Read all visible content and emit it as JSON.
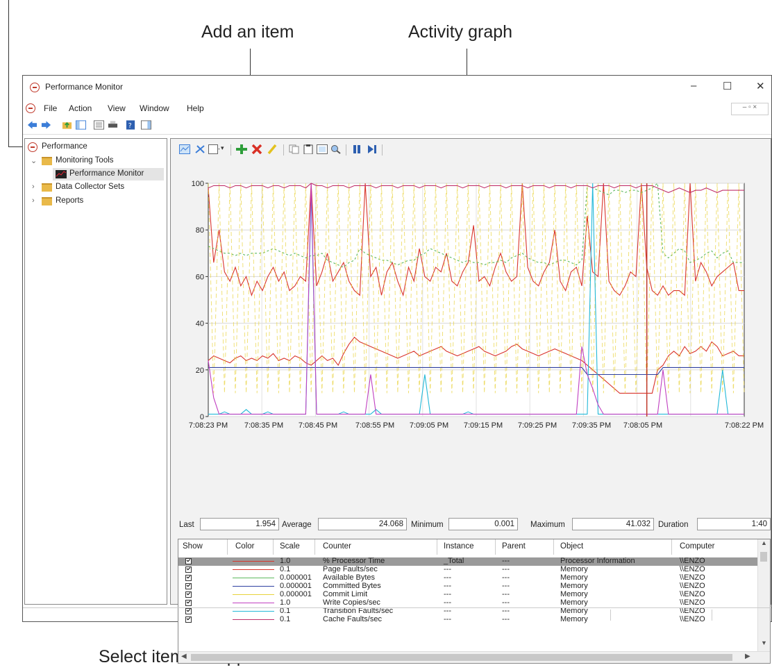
{
  "callouts": {
    "add_item": "Add an item",
    "activity_graph": "Activity graph",
    "select_items": "Select items to appear"
  },
  "window": {
    "title": "Performance Monitor",
    "minimize": "–",
    "maximize": "☐",
    "close": "✕",
    "mdi_buttons": "–  ▫  ×"
  },
  "menu": [
    "File",
    "Action",
    "View",
    "Window",
    "Help"
  ],
  "tree": {
    "root": "Performance",
    "monitoring_tools": "Monitoring Tools",
    "performance_monitor": "Performance Monitor",
    "data_collector_sets": "Data Collector Sets",
    "reports": "Reports"
  },
  "colors": {
    "accent_blue": "#3b7dd8",
    "add_green": "#2e9e3a",
    "delete_red": "#d93025",
    "highlight_yellow": "#e3c21f"
  },
  "icons": [
    "performance-icon",
    "back-icon",
    "forward-icon",
    "up-folder-icon",
    "console-tree-icon",
    "properties-icon",
    "export-icon",
    "help-icon",
    "action-pane-icon",
    "view-graph-icon",
    "freeze-icon",
    "change-graph-type-icon",
    "add-counter-icon",
    "delete-counter-icon",
    "highlight-icon",
    "copy-icon",
    "paste-icon",
    "properties-icon",
    "zoom-icon",
    "pause-icon",
    "update-data-icon"
  ],
  "stats": {
    "last_label": "Last",
    "last_value": "1.954",
    "average_label": "Average",
    "average_value": "24.068",
    "minimum_label": "Minimum",
    "minimum_value": "0.001",
    "maximum_label": "Maximum",
    "maximum_value": "41.032",
    "duration_label": "Duration",
    "duration_value": "1:40"
  },
  "counter_table": {
    "headers": [
      "Show",
      "Color",
      "Scale",
      "Counter",
      "Instance",
      "Parent",
      "Object",
      "Computer"
    ],
    "rows": [
      {
        "show": true,
        "color": "#d9342b",
        "scale": "1.0",
        "counter": "% Processor Time",
        "instance": "_Total",
        "parent": "---",
        "object": "Processor Information",
        "computer": "\\\\ENZO",
        "selected": true
      },
      {
        "show": true,
        "color": "#d9342b",
        "scale": "0.1",
        "counter": "Page Faults/sec",
        "instance": "---",
        "parent": "---",
        "object": "Memory",
        "computer": "\\\\ENZO"
      },
      {
        "show": true,
        "color": "#5cb85c",
        "scale": "0.000001",
        "counter": "Available Bytes",
        "instance": "---",
        "parent": "---",
        "object": "Memory",
        "computer": "\\\\ENZO"
      },
      {
        "show": true,
        "color": "#2d3fa0",
        "scale": "0.000001",
        "counter": "Committed Bytes",
        "instance": "---",
        "parent": "---",
        "object": "Memory",
        "computer": "\\\\ENZO"
      },
      {
        "show": true,
        "color": "#e8d23a",
        "scale": "0.000001",
        "counter": "Commit Limit",
        "instance": "---",
        "parent": "---",
        "object": "Memory",
        "computer": "\\\\ENZO"
      },
      {
        "show": true,
        "color": "#c03fc0",
        "scale": "1.0",
        "counter": "Write Copies/sec",
        "instance": "---",
        "parent": "---",
        "object": "Memory",
        "computer": "\\\\ENZO"
      },
      {
        "show": true,
        "color": "#22b8d8",
        "scale": "0.1",
        "counter": "Transition Faults/sec",
        "instance": "---",
        "parent": "---",
        "object": "Memory",
        "computer": "\\\\ENZO"
      },
      {
        "show": true,
        "color": "#c0306a",
        "scale": "0.1",
        "counter": "Cache Faults/sec",
        "instance": "---",
        "parent": "---",
        "object": "Memory",
        "computer": "\\\\ENZO"
      }
    ]
  },
  "chart_data": {
    "type": "line",
    "yticks": [
      "100",
      "80",
      "60",
      "40",
      "20",
      "0"
    ],
    "ylim": [
      0,
      100
    ],
    "xticks": [
      "7:08:23 PM",
      "7:08:35 PM",
      "7:08:45 PM",
      "7:08:55 PM",
      "7:09:05 PM",
      "7:09:15 PM",
      "7:09:25 PM",
      "7:09:35 PM",
      "7:08:05 PM",
      "7:08:22 PM"
    ],
    "grid": true,
    "sample_count": 100,
    "series": [
      {
        "color": "#d9342b",
        "style": "solid",
        "values": [
          98,
          66,
          80,
          62,
          58,
          64,
          56,
          60,
          52,
          58,
          54,
          60,
          64,
          58,
          62,
          54,
          56,
          60,
          58,
          100,
          56,
          62,
          70,
          58,
          62,
          66,
          58,
          54,
          52,
          100,
          60,
          64,
          52,
          62,
          66,
          58,
          52,
          64,
          58,
          72,
          60,
          58,
          64,
          62,
          70,
          58,
          56,
          62,
          66,
          82,
          58,
          60,
          56,
          64,
          70,
          62,
          58,
          60,
          100,
          64,
          58,
          56,
          62,
          66,
          80,
          58,
          54,
          62,
          64,
          56,
          86,
          62,
          60,
          100,
          58,
          54,
          52,
          56,
          62,
          60,
          100,
          64,
          54,
          52,
          56,
          52,
          54,
          54,
          52,
          100,
          58,
          66,
          62,
          56,
          60,
          62,
          64,
          66,
          54,
          54
        ]
      },
      {
        "color": "#d9342b",
        "style": "solid",
        "values": [
          24,
          26,
          25,
          24,
          23,
          25,
          26,
          24,
          25,
          24,
          26,
          25,
          27,
          24,
          25,
          24,
          26,
          25,
          23,
          22,
          24,
          26,
          24,
          25,
          22,
          27,
          31,
          34,
          32,
          31,
          30,
          29,
          28,
          27,
          26,
          25,
          26,
          27,
          28,
          26,
          27,
          28,
          29,
          30,
          28,
          27,
          26,
          27,
          28,
          29,
          30,
          28,
          27,
          26,
          27,
          28,
          30,
          31,
          29,
          28,
          27,
          26,
          27,
          28,
          29,
          28,
          27,
          26,
          25,
          24,
          22,
          20,
          18,
          16,
          14,
          12,
          10,
          10,
          10,
          10,
          10,
          10,
          10,
          20,
          22,
          26,
          28,
          26,
          30,
          27,
          28,
          30,
          28,
          32,
          30,
          26,
          27,
          28,
          26,
          26
        ]
      },
      {
        "color": "#5cb85c",
        "style": "dashed",
        "values": [
          73,
          72,
          71,
          70,
          70,
          69,
          70,
          69,
          70,
          70,
          70,
          71,
          72,
          71,
          70,
          69,
          70,
          69,
          68,
          69,
          69,
          70,
          67,
          66,
          65,
          64,
          66,
          67,
          72,
          70,
          69,
          68,
          67,
          67,
          66,
          65,
          66,
          67,
          67,
          69,
          70,
          72,
          71,
          70,
          69,
          68,
          67,
          66,
          67,
          66,
          66,
          65,
          66,
          66,
          67,
          66,
          68,
          69,
          70,
          68,
          67,
          66,
          66,
          65,
          66,
          67,
          67,
          66,
          65,
          67,
          99,
          98,
          97,
          96,
          95,
          97,
          97,
          96,
          97,
          97,
          96,
          97,
          98,
          100,
          70,
          68,
          70,
          72,
          71,
          66,
          67,
          68,
          70,
          71,
          68,
          70,
          71,
          66,
          66,
          66
        ]
      },
      {
        "color": "#e8d23a",
        "style": "dashed",
        "values": [
          100,
          10,
          100,
          10,
          100,
          10,
          100,
          10,
          100,
          10,
          100,
          10,
          100,
          10,
          100,
          10,
          100,
          10,
          100,
          10,
          100,
          10,
          100,
          10,
          100,
          10,
          100,
          10,
          100,
          10,
          100,
          10,
          100,
          10,
          100,
          10,
          100,
          10,
          100,
          10,
          100,
          10,
          100,
          10,
          100,
          10,
          100,
          10,
          100,
          10,
          100,
          10,
          100,
          10,
          100,
          10,
          100,
          10,
          100,
          10,
          100,
          10,
          100,
          10,
          100,
          10,
          100,
          10,
          100,
          10,
          100,
          10,
          100,
          10,
          100,
          10,
          100,
          10,
          100,
          10,
          100,
          10,
          100,
          10,
          100,
          10,
          100,
          10,
          100,
          10,
          100,
          10,
          100,
          10,
          100,
          10,
          100,
          10,
          100,
          10
        ]
      },
      {
        "color": "#2d3fa0",
        "style": "solid",
        "values": [
          21,
          21,
          21,
          21,
          21,
          21,
          21,
          21,
          21,
          21,
          21,
          21,
          21,
          21,
          21,
          21,
          21,
          21,
          21,
          21,
          21,
          21,
          21,
          21,
          21,
          21,
          21,
          21,
          21,
          21,
          21,
          21,
          21,
          21,
          21,
          21,
          21,
          21,
          21,
          21,
          21,
          21,
          21,
          21,
          21,
          21,
          21,
          21,
          21,
          21,
          21,
          21,
          21,
          21,
          21,
          21,
          21,
          21,
          21,
          21,
          21,
          21,
          21,
          21,
          21,
          21,
          21,
          21,
          21,
          21,
          18,
          18,
          18,
          18,
          18,
          18,
          18,
          18,
          18,
          18,
          18,
          18,
          18,
          18,
          21,
          21,
          21,
          21,
          21,
          21,
          21,
          21,
          21,
          21,
          21,
          21,
          21,
          21,
          21,
          21
        ]
      },
      {
        "color": "#22b8d8",
        "style": "solid",
        "values": [
          1,
          1,
          1,
          2,
          1,
          1,
          1,
          3,
          1,
          1,
          1,
          2,
          1,
          1,
          1,
          1,
          1,
          1,
          1,
          95,
          1,
          1,
          1,
          1,
          1,
          2,
          1,
          1,
          1,
          1,
          1,
          3,
          1,
          1,
          1,
          1,
          1,
          1,
          1,
          1,
          18,
          1,
          1,
          1,
          1,
          1,
          1,
          1,
          2,
          1,
          1,
          1,
          1,
          1,
          1,
          1,
          1,
          1,
          1,
          1,
          1,
          1,
          1,
          1,
          1,
          1,
          1,
          1,
          1,
          1,
          1,
          100,
          1,
          1,
          1,
          1,
          1,
          1,
          1,
          1,
          1,
          1,
          1,
          1,
          1,
          1,
          1,
          1,
          1,
          1,
          1,
          1,
          1,
          1,
          1,
          20,
          1,
          1,
          1,
          1
        ]
      },
      {
        "color": "#c03fc0",
        "style": "solid",
        "values": [
          24,
          8,
          1,
          1,
          1,
          1,
          1,
          1,
          1,
          1,
          1,
          1,
          1,
          1,
          1,
          1,
          1,
          1,
          1,
          100,
          1,
          1,
          1,
          1,
          1,
          1,
          1,
          1,
          1,
          1,
          18,
          1,
          1,
          1,
          1,
          1,
          1,
          1,
          1,
          1,
          1,
          1,
          1,
          1,
          1,
          1,
          1,
          1,
          1,
          1,
          1,
          1,
          1,
          1,
          1,
          1,
          1,
          1,
          1,
          1,
          1,
          1,
          1,
          1,
          1,
          1,
          1,
          1,
          1,
          30,
          18,
          12,
          5,
          1,
          1,
          1,
          1,
          1,
          1,
          1,
          1,
          1,
          1,
          1,
          20,
          1,
          1,
          1,
          1,
          1,
          1,
          1,
          1,
          1,
          1,
          1,
          1,
          1,
          1,
          1
        ]
      },
      {
        "color": "#c0306a",
        "style": "solid",
        "values": [
          98,
          99,
          99,
          99,
          98,
          99,
          99,
          98,
          99,
          99,
          99,
          98,
          99,
          99,
          98,
          99,
          99,
          99,
          98,
          100,
          99,
          99,
          98,
          99,
          99,
          99,
          98,
          99,
          99,
          99,
          99,
          98,
          99,
          99,
          99,
          98,
          99,
          99,
          99,
          98,
          99,
          99,
          99,
          98,
          99,
          99,
          99,
          98,
          99,
          99,
          99,
          98,
          99,
          99,
          99,
          98,
          99,
          99,
          99,
          98,
          99,
          99,
          99,
          98,
          99,
          99,
          99,
          98,
          99,
          99,
          99,
          98,
          99,
          99,
          99,
          98,
          99,
          99,
          99,
          98,
          99,
          99,
          99,
          98,
          97,
          96,
          97,
          98,
          97,
          96,
          97,
          97,
          98,
          97,
          96,
          97,
          97,
          97,
          97,
          97
        ]
      }
    ]
  }
}
